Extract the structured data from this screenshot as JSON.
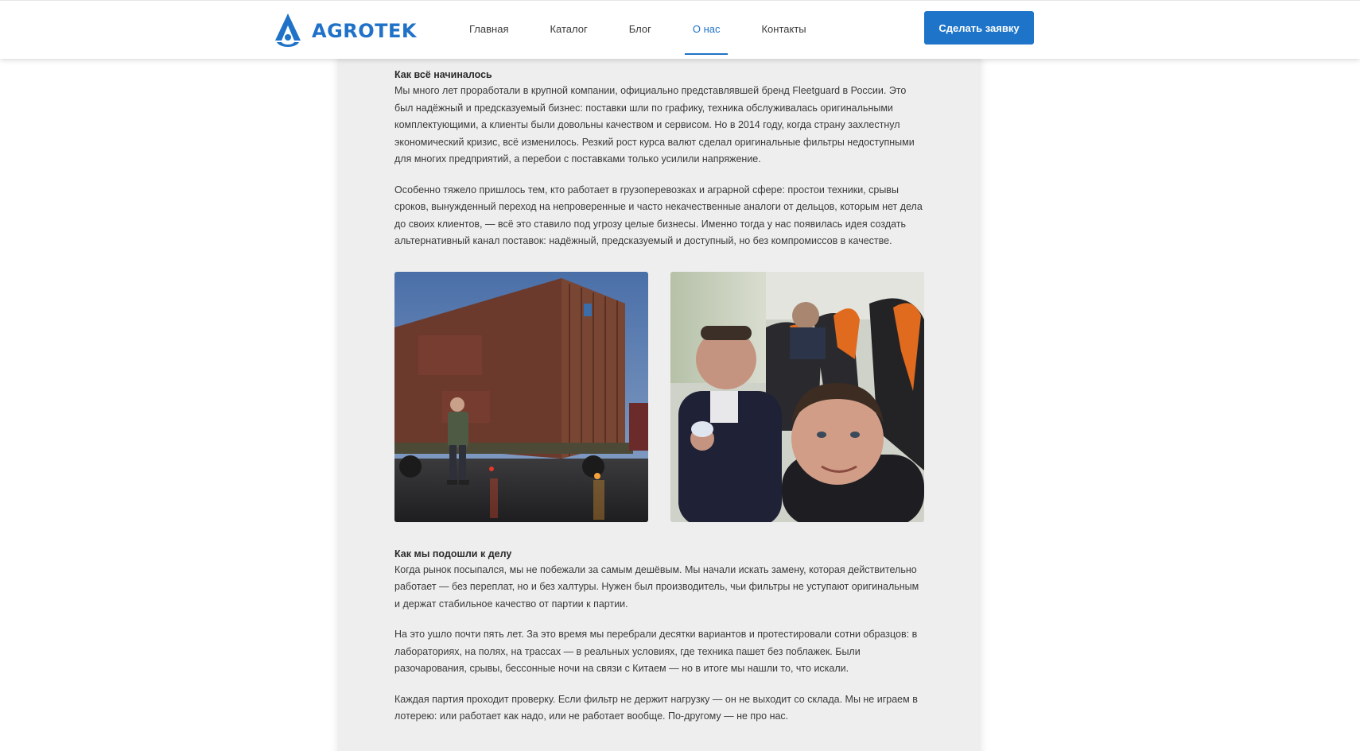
{
  "header": {
    "brand": "AGROTEK",
    "nav": [
      {
        "label": "Главная",
        "active": false
      },
      {
        "label": "Каталог",
        "active": false
      },
      {
        "label": "Блог",
        "active": false
      },
      {
        "label": "О нас",
        "active": true
      },
      {
        "label": "Контакты",
        "active": false
      }
    ],
    "cta_label": "Сделать заявку"
  },
  "section1": {
    "title": "Как всё начиналось",
    "paragraphs": [
      "Мы много лет проработали в крупной компании, официально представлявшей бренд Fleetguard в России. Это был надёжный и предсказуемый бизнес: поставки шли по графику, техника обслуживалась оригинальными комплектующими, а клиенты были довольны качеством и сервисом. Но в 2014 году, когда страну захлестнул экономический кризис, всё изменилось. Резкий рост курса валют сделал оригинальные фильтры недоступными для многих предприятий, а перебои с поставками только усилили напряжение.",
      "Особенно тяжело пришлось тем, кто работает в грузоперевозках и аграрной сфере: простои техники, срывы сроков, вынужденный переход на непроверенные и часто некачественные аналоги от дельцов, которым нет дела до своих клиентов, — всё это ставило под угрозу целые бизнесы. Именно тогда у нас появилась идея создать альтернативный канал поставок: надёжный, предсказуемый и доступный, но без компромиссов в качестве."
    ]
  },
  "photos": [
    {
      "name": "container-photo"
    },
    {
      "name": "bus-selfie-photo"
    }
  ],
  "section2": {
    "title": "Как мы подошли к делу",
    "paragraphs": [
      "Когда рынок посыпался, мы не побежали за самым дешёвым. Мы начали искать замену, которая действительно работает — без переплат, но и без халтуры. Нужен был производитель, чьи фильтры не уступают оригинальным и держат стабильное качество от партии к партии.",
      "На это ушло почти пять лет. За это время мы перебрали десятки вариантов и протестировали сотни образцов: в лабораториях, на полях, на трассах — в реальных условиях, где техника пашет без поблажек. Были разочарования, срывы, бессонные ночи на связи с Китаем — но в итоге мы нашли то, что искали.",
      "Каждая партия проходит проверку. Если фильтр не держит нагрузку — он не выходит со склада. Мы не играем в лотерею: или работает как надо, или не работает вообще. По-другому — не про нас."
    ]
  },
  "colors": {
    "accent": "#1f72c7",
    "card_bg": "#eeeeee"
  }
}
